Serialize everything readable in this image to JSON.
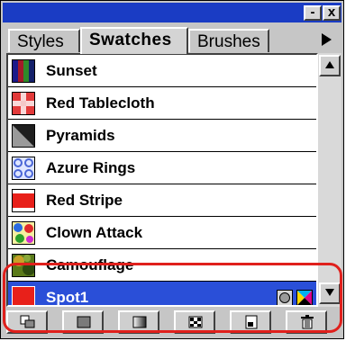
{
  "panel": {
    "tabs": [
      {
        "label": "Styles",
        "active": false
      },
      {
        "label": "Swatches",
        "active": true
      },
      {
        "label": "Brushes",
        "active": false
      }
    ],
    "window_buttons": {
      "minimize": "-",
      "close": "x"
    },
    "tab_menu_icon": "triangle-right-icon"
  },
  "swatches": [
    {
      "name": "Sunset",
      "swatch": "sunset"
    },
    {
      "name": "Red Tablecloth",
      "swatch": "red-tablecloth"
    },
    {
      "name": "Pyramids",
      "swatch": "pyramids"
    },
    {
      "name": "Azure Rings",
      "swatch": "azure-rings"
    },
    {
      "name": "Red Stripe",
      "swatch": "red-stripe"
    },
    {
      "name": "Clown Attack",
      "swatch": "clown-attack"
    },
    {
      "name": "Camouflage",
      "swatch": "camouflage"
    },
    {
      "name": "Spot1",
      "swatch": "spot-red",
      "selected": true,
      "color": "#e8201a"
    }
  ],
  "spot_indicators": [
    "spot-color-icon",
    "process-color-icon"
  ],
  "toolbar": [
    "show-swatch-kinds-icon",
    "show-color-swatches-icon",
    "show-gradient-swatches-icon",
    "show-pattern-swatches-icon",
    "new-swatch-icon",
    "delete-swatch-icon"
  ],
  "colors": {
    "titlebar": "#1a3cc4",
    "selection": "#2a4fd8",
    "highlight": "#e0201c"
  }
}
